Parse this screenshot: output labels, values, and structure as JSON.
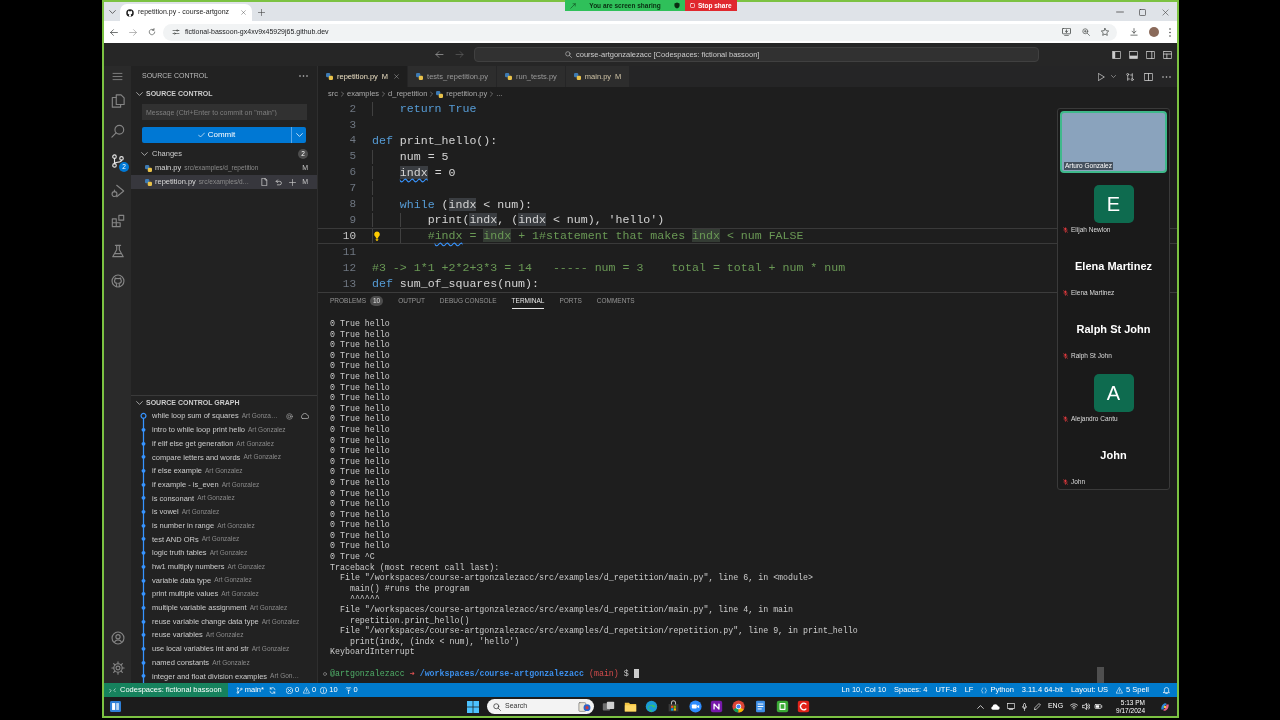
{
  "share_banner": {
    "status": "You are screen sharing",
    "stop": "Stop share"
  },
  "browser": {
    "tab_title": "repetition.py - course-artgonz",
    "url": "fictional-bassoon-gx4xv9x45929j65.github.dev"
  },
  "title_bar": {
    "command_center": "course-artgonzalezacc [Codespaces: fictional bassoon]"
  },
  "activity_bar": [
    {
      "kind": "menu",
      "selected": false
    },
    {
      "kind": "explorer",
      "selected": false
    },
    {
      "kind": "search",
      "selected": false
    },
    {
      "kind": "source-control",
      "selected": true,
      "badge": "2"
    },
    {
      "kind": "run-debug",
      "selected": false
    },
    {
      "kind": "extensions",
      "selected": false
    },
    {
      "kind": "testing",
      "selected": false
    },
    {
      "kind": "github",
      "selected": false
    }
  ],
  "activity_bar_bottom": [
    {
      "kind": "account"
    },
    {
      "kind": "settings"
    }
  ],
  "sidebar": {
    "title": "SOURCE CONTROL",
    "section": {
      "title": "SOURCE CONTROL",
      "expanded": true
    },
    "message_placeholder": "Message (Ctrl+Enter to commit on \"main\")",
    "commit_label": "Commit",
    "changes": {
      "label": "Changes",
      "count": "2",
      "expanded": true,
      "files": [
        {
          "name": "main.py",
          "path": "src/examples/d_repetition",
          "status": "M",
          "selected": false
        },
        {
          "name": "repetition.py",
          "path": "src/examples/d…",
          "status": "M",
          "selected": true
        }
      ]
    },
    "graph": {
      "title": "SOURCE CONTROL GRAPH",
      "expanded": true,
      "commits": [
        {
          "message": "while loop sum of squares",
          "author": "Art Gonza…",
          "head": true
        },
        {
          "message": "intro to while loop print hello",
          "author": "Art Gonzalez",
          "head": false
        },
        {
          "message": "if elif else get generation",
          "author": "Art Gonzalez",
          "head": false
        },
        {
          "message": "compare letters and words",
          "author": "Art Gonzalez",
          "head": false
        },
        {
          "message": "if else example",
          "author": "Art Gonzalez",
          "head": false
        },
        {
          "message": "if example - is_even",
          "author": "Art Gonzalez",
          "head": false
        },
        {
          "message": "is consonant",
          "author": "Art Gonzalez",
          "head": false
        },
        {
          "message": "is vowel",
          "author": "Art Gonzalez",
          "head": false
        },
        {
          "message": "is number in range",
          "author": "Art Gonzalez",
          "head": false
        },
        {
          "message": "test AND ORs",
          "author": "Art Gonzalez",
          "head": false
        },
        {
          "message": "logic truth tables",
          "author": "Art Gonzalez",
          "head": false
        },
        {
          "message": "hw1 multiply numbers",
          "author": "Art Gonzalez",
          "head": false
        },
        {
          "message": "variable data type",
          "author": "Art Gonzalez",
          "head": false
        },
        {
          "message": "print multiple values",
          "author": "Art Gonzalez",
          "head": false
        },
        {
          "message": "multiple variable assignment",
          "author": "Art Gonzalez",
          "head": false
        },
        {
          "message": "reuse variable change data type",
          "author": "Art Gonzalez",
          "head": false
        },
        {
          "message": "reuse variables",
          "author": "Art Gonzalez",
          "head": false
        },
        {
          "message": "use local variables int and str",
          "author": "Art Gonzalez",
          "head": false
        },
        {
          "message": "named constants",
          "author": "Art Gonzalez",
          "head": false
        },
        {
          "message": "integer and float division examples",
          "author": "Art Gon…",
          "head": false
        }
      ]
    }
  },
  "editor": {
    "tabs": [
      {
        "label": "repetition.py",
        "status": "M",
        "selected": true
      },
      {
        "label": "tests_repetition.py",
        "selected": false
      },
      {
        "label": "run_tests.py",
        "selected": false
      },
      {
        "label": "main.py",
        "status": "M",
        "selected": false
      }
    ],
    "breadcrumb": [
      {
        "label": "src",
        "kind": "folder"
      },
      {
        "label": "examples",
        "kind": "folder"
      },
      {
        "label": "d_repetition",
        "kind": "folder"
      },
      {
        "label": "repetition.py",
        "kind": "file"
      },
      {
        "label": "...",
        "kind": "more"
      }
    ],
    "lines": [
      {
        "number": "2",
        "kind": "block",
        "current": false,
        "lightbulb": false,
        "tokens": [
          {
            "text": "return True",
            "kind": "keyword"
          }
        ]
      },
      {
        "number": "3",
        "kind": "top",
        "current": false,
        "lightbulb": false
      },
      {
        "number": "4",
        "kind": "top",
        "current": false,
        "lightbulb": false,
        "tokens": [
          {
            "text": "def",
            "kind": "keyword"
          },
          {
            "text": " print_hello():",
            "kind": "plain"
          }
        ]
      },
      {
        "number": "5",
        "kind": "block",
        "current": false,
        "lightbulb": false,
        "tokens": [
          {
            "text": "num = 5",
            "kind": "plain"
          }
        ]
      },
      {
        "number": "6",
        "kind": "block",
        "current": false,
        "lightbulb": false,
        "tokens": [
          {
            "text": "indx",
            "kind": "highlight-squiggle"
          },
          {
            "text": " = 0",
            "kind": "plain"
          }
        ]
      },
      {
        "number": "7",
        "kind": "block",
        "current": false,
        "lightbulb": false
      },
      {
        "number": "8",
        "kind": "block",
        "current": false,
        "lightbulb": false,
        "tokens": [
          {
            "text": "while",
            "kind": "keyword"
          },
          {
            "text": " (",
            "kind": "plain"
          },
          {
            "text": "indx",
            "kind": "highlight"
          },
          {
            "text": " < num):",
            "kind": "plain"
          }
        ]
      },
      {
        "number": "9",
        "kind": "inner-block",
        "current": false,
        "lightbulb": false,
        "tokens": [
          {
            "text": "print(",
            "kind": "plain"
          },
          {
            "text": "indx",
            "kind": "highlight"
          },
          {
            "text": ", (",
            "kind": "plain"
          },
          {
            "text": "indx",
            "kind": "highlight"
          },
          {
            "text": " < num), 'hello')",
            "kind": "plain"
          }
        ]
      },
      {
        "number": "10",
        "kind": "inner-block",
        "current": true,
        "lightbulb": true,
        "tokens": [
          {
            "text": "#",
            "kind": "comment"
          },
          {
            "text": "indx",
            "kind": "comment-squiggle"
          },
          {
            "text": " = ",
            "kind": "comment"
          },
          {
            "text": "indx",
            "kind": "comment-highlight"
          },
          {
            "text": " + 1#statement that makes ",
            "kind": "comment"
          },
          {
            "text": "indx",
            "kind": "comment-highlight"
          },
          {
            "text": " < num FALSE",
            "kind": "comment"
          }
        ]
      },
      {
        "number": "11",
        "kind": "top",
        "current": false,
        "lightbulb": false
      },
      {
        "number": "12",
        "kind": "top",
        "current": false,
        "lightbulb": false,
        "tokens": [
          {
            "text": "#3 -> 1*1 +2*2+3*3 = 14   ----- num = 3    total = total + num * num",
            "kind": "comment"
          }
        ]
      },
      {
        "number": "13",
        "kind": "top",
        "current": false,
        "lightbulb": false,
        "tokens": [
          {
            "text": "def",
            "kind": "keyword"
          },
          {
            "text": " sum_of_squares(num):",
            "kind": "plain"
          }
        ]
      }
    ]
  },
  "panel": {
    "tabs": [
      {
        "label": "PROBLEMS",
        "badge": "10",
        "selected": false
      },
      {
        "label": "OUTPUT",
        "selected": false
      },
      {
        "label": "DEBUG CONSOLE",
        "selected": false
      },
      {
        "label": "TERMINAL",
        "selected": true
      },
      {
        "label": "PORTS",
        "selected": false
      },
      {
        "label": "COMMENTS",
        "selected": false
      }
    ]
  },
  "terminal": {
    "lines": [
      "0 True hello",
      "0 True hello",
      "0 True hello",
      "0 True hello",
      "0 True hello",
      "0 True hello",
      "0 True hello",
      "0 True hello",
      "0 True hello",
      "0 True hello",
      "0 True hello",
      "0 True hello",
      "0 True hello",
      "0 True hello",
      "0 True hello",
      "0 True hello",
      "0 True hello",
      "0 True hello",
      "0 True hello",
      "0 True hello",
      "0 True hello",
      "0 True hello",
      "0 True ^C",
      "Traceback (most recent call last):",
      "  File \"/workspaces/course-artgonzalezacc/src/examples/d_repetition/main.py\", line 6, in <module>",
      "    main() #runs the program",
      "    ^^^^^^",
      "  File \"/workspaces/course-artgonzalezacc/src/examples/d_repetition/main.py\", line 4, in main",
      "    repetition.print_hello()",
      "  File \"/workspaces/course-artgonzalezacc/src/examples/d_repetition/repetition.py\", line 9, in print_hello",
      "    print(indx, (indx < num), 'hello')",
      "KeyboardInterrupt"
    ],
    "prompt": {
      "user": "@artgonzalezacc",
      "arrow": "➜",
      "path": "/workspaces/course-artgonzalezacc",
      "branch": "(main)",
      "symbol": "$"
    }
  },
  "status_bar": {
    "remote": "Codespaces: fictional bassoon",
    "branch": "main*",
    "errors": "0",
    "warnings": "0",
    "infos": "10",
    "ports": "0",
    "items": [
      {
        "kind": "text",
        "label": "Ln 10, Col 10"
      },
      {
        "kind": "text",
        "label": "Spaces: 4"
      },
      {
        "kind": "text",
        "label": "UTF-8"
      },
      {
        "kind": "text",
        "label": "LF"
      },
      {
        "kind": "language",
        "label": "Python"
      },
      {
        "kind": "text",
        "label": "3.11.4 64-bit"
      },
      {
        "kind": "text",
        "label": "Layout: US"
      },
      {
        "kind": "spell",
        "label": "5 Spell"
      }
    ]
  },
  "zoom_panel": {
    "participants": [
      {
        "kind": "video",
        "name": "Arturo Gonzalez",
        "muted": false
      },
      {
        "kind": "avatar",
        "initial": "E",
        "name": "Elijah Newlon",
        "muted": true
      },
      {
        "kind": "name",
        "display": "Elena Martinez",
        "name": "Elena Martinez",
        "muted": true
      },
      {
        "kind": "name",
        "display": "Ralph St John",
        "name": "Ralph St John",
        "muted": true
      },
      {
        "kind": "avatar",
        "initial": "A",
        "name": "Alejandro Cantu",
        "muted": true
      },
      {
        "kind": "name",
        "display": "John",
        "name": "John",
        "muted": true
      }
    ]
  },
  "taskbar": {
    "search_placeholder": "Search",
    "apps": [
      {
        "kind": "task-view"
      },
      {
        "kind": "folder"
      },
      {
        "kind": "edge"
      },
      {
        "kind": "store"
      },
      {
        "kind": "zoom"
      },
      {
        "kind": "onenote"
      },
      {
        "kind": "chrome"
      },
      {
        "kind": "notepad"
      },
      {
        "kind": "green-tile"
      },
      {
        "kind": "red-tile"
      }
    ],
    "language": "ENG",
    "time": "5:13 PM",
    "date": "9/17/2024"
  }
}
